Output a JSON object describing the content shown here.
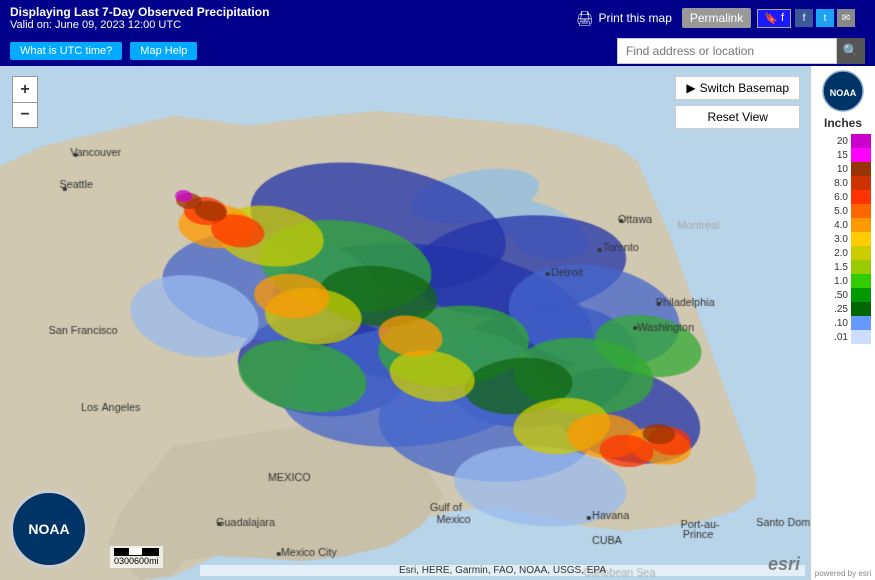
{
  "header": {
    "title_line1": "Displaying Last 7-Day Observed Precipitation",
    "title_line2": "Valid on: June 09, 2023 12:00 UTC",
    "print_label": "Print this map",
    "permalink_label": "Permalink",
    "bookmark_label": "🔖 BOOKMARK",
    "fb_label": "f",
    "twitter_label": "t",
    "email_label": "✉"
  },
  "subheader": {
    "utc_btn": "What is UTC time?",
    "help_btn": "Map Help",
    "search_placeholder": "Find address or location"
  },
  "map_controls": {
    "switch_basemap": "Switch Basemap",
    "reset_view": "Reset View",
    "zoom_in": "+",
    "zoom_out": "−"
  },
  "legend": {
    "unit": "Inches",
    "items": [
      {
        "label": "20",
        "color": "#cc00cc"
      },
      {
        "label": "15",
        "color": "#ff00ff"
      },
      {
        "label": "10",
        "color": "#993300"
      },
      {
        "label": "8.0",
        "color": "#cc3300"
      },
      {
        "label": "6.0",
        "color": "#ff3300"
      },
      {
        "label": "5.0",
        "color": "#ff6600"
      },
      {
        "label": "4.0",
        "color": "#ff9900"
      },
      {
        "label": "3.0",
        "color": "#ffcc00"
      },
      {
        "label": "2.0",
        "color": "#cccc00"
      },
      {
        "label": "1.5",
        "color": "#99cc00"
      },
      {
        "label": "1.0",
        "color": "#33cc00"
      },
      {
        "label": ".50",
        "color": "#009900"
      },
      {
        "label": ".25",
        "color": "#006600"
      },
      {
        "label": ".10",
        "color": "#6699ff"
      },
      {
        "label": ".01",
        "color": "#ccddff"
      }
    ],
    "esri_credit": "powered by esri"
  },
  "scale": {
    "labels": [
      "0",
      "300",
      "600mi"
    ]
  },
  "attribution": "Esri, HERE, Garmin, FAO, NOAA, USGS, EPA",
  "noaa_label": "NOAA",
  "esri_logo": "esri"
}
